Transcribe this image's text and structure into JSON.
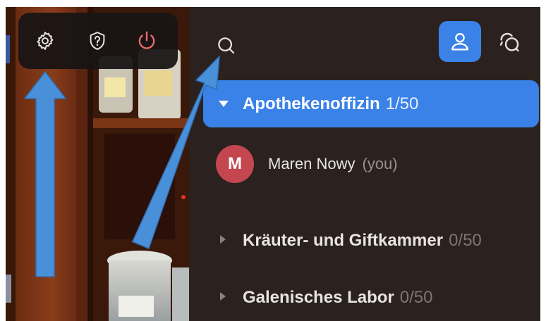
{
  "toolbar": {
    "icons": [
      "gear-icon",
      "help-icon",
      "power-icon"
    ]
  },
  "panel": {
    "header_icons": [
      "search-icon",
      "people-icon",
      "chat-icon"
    ],
    "channels": [
      {
        "name": "Apothekenoffizin",
        "count": "1/50",
        "expanded": true
      },
      {
        "name": "Kräuter- und Giftkammer",
        "count": "0/50",
        "expanded": false
      },
      {
        "name": "Galenisches Labor",
        "count": "0/50",
        "expanded": false
      }
    ],
    "user": {
      "initial": "M",
      "name": "Maren Nowy",
      "tag": "(you)"
    }
  },
  "colors": {
    "accent": "#3a82e8",
    "panel_bg": "#2b2220",
    "toolbar_bg": "#181414",
    "power": "#e86a6a",
    "avatar": "#c4474f",
    "arrow": "#4a90d9"
  }
}
